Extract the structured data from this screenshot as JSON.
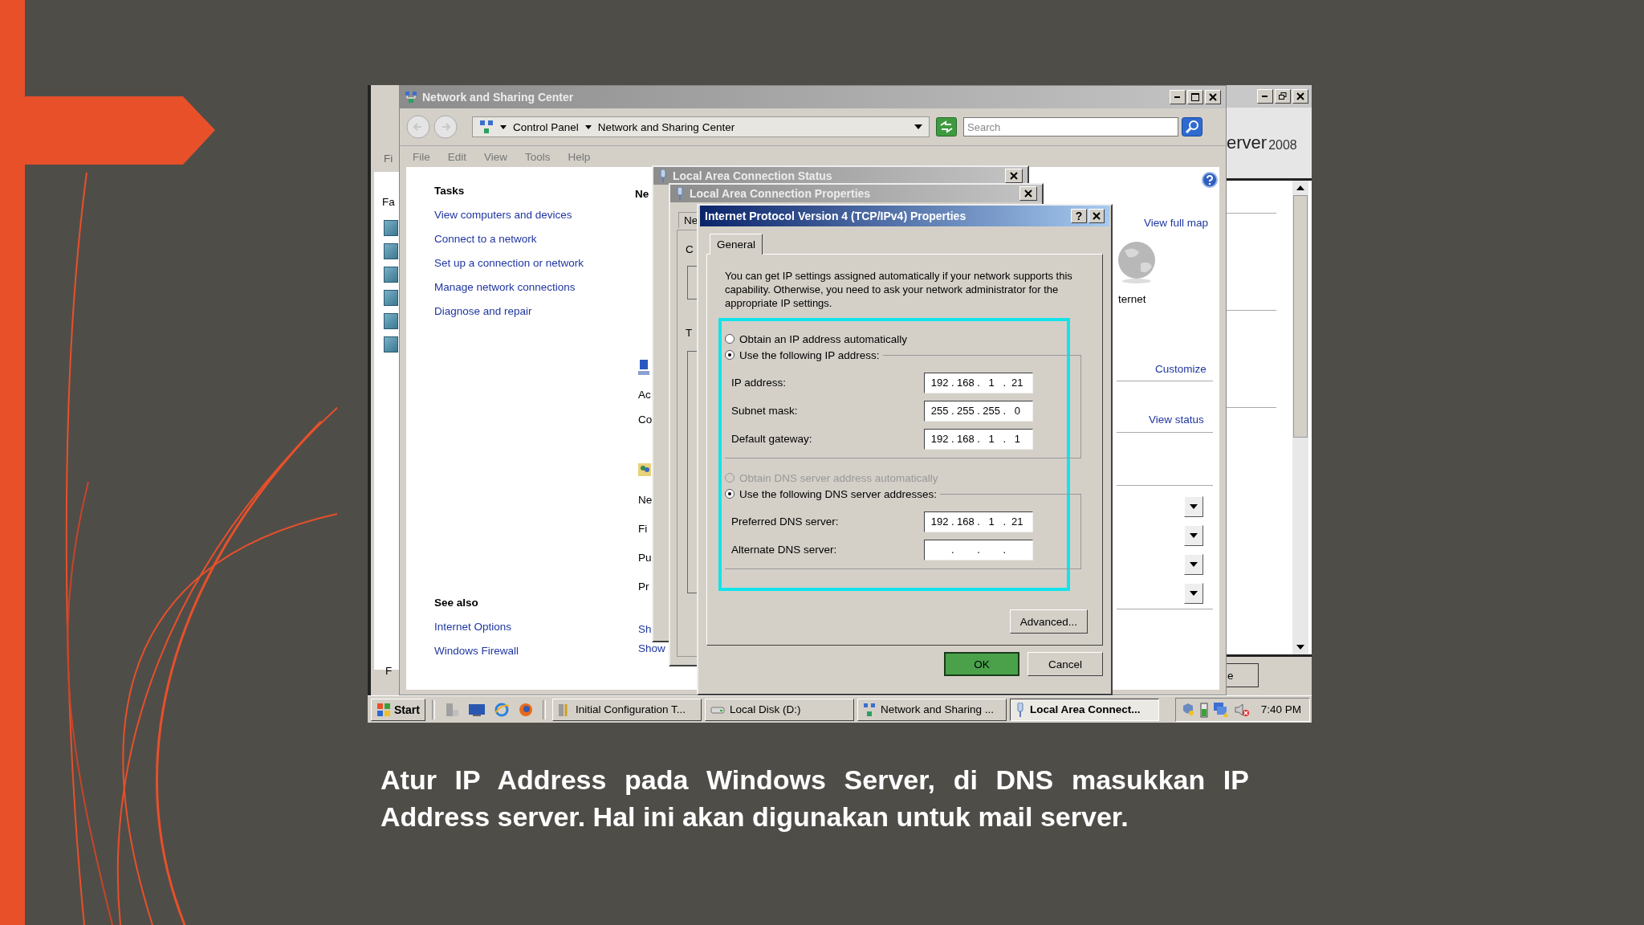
{
  "left_window": {
    "menu_fragment": "Fi",
    "label_fragment": "Fa",
    "footer_fragment": "F"
  },
  "server_window": {
    "brand_fragment": "erver",
    "version": "2008",
    "button_fragment": "e"
  },
  "nsc_window": {
    "title": "Network and Sharing Center",
    "breadcrumbs": [
      "Control Panel",
      "Network and Sharing Center"
    ],
    "search": {
      "placeholder": "Search"
    },
    "menu": [
      "File",
      "Edit",
      "View",
      "Tools",
      "Help"
    ],
    "tasks": {
      "heading": "Tasks",
      "links": [
        "View computers and devices",
        "Connect to a network",
        "Set up a connection or network",
        "Manage network connections",
        "Diagnose and repair"
      ]
    },
    "see_also": {
      "heading": "See also",
      "links": [
        "Internet Options",
        "Windows Firewall"
      ]
    },
    "middle": {
      "heading": "Ne",
      "items": [
        {
          "text": "Ac",
          "kind": "label"
        },
        {
          "text": "Co",
          "kind": "label"
        },
        {
          "text": "Ne",
          "kind": "label"
        },
        {
          "text": "Fi",
          "kind": "label"
        },
        {
          "text": "Pu",
          "kind": "label"
        },
        {
          "text": "Pr",
          "kind": "label"
        },
        {
          "text": "Sh",
          "kind": "link"
        },
        {
          "text": "Show",
          "kind": "link"
        }
      ]
    },
    "map": {
      "link": "View full map",
      "node": "ternet"
    },
    "customize": "Customize",
    "view_status": "View status"
  },
  "status_dialog": {
    "title": "Local Area Connection Status"
  },
  "properties_dialog": {
    "title": "Local Area Connection Properties",
    "tab_fragment": "Ne",
    "fragments": [
      "C",
      "T"
    ]
  },
  "ipv4_dialog": {
    "title": "Internet Protocol Version 4 (TCP/IPv4) Properties",
    "help": "?",
    "tabs": [
      {
        "label": "General",
        "selected": true
      }
    ],
    "description": "You can get IP settings assigned automatically if your network supports this capability. Otherwise, you need to ask your network administrator for the appropriate IP settings.",
    "separator": ".",
    "ip_modes": [
      {
        "label": "Obtain an IP address automatically",
        "selected": false,
        "disabled": false
      },
      {
        "label": "Use the following IP address:",
        "selected": true,
        "disabled": false
      }
    ],
    "ip_fields": [
      {
        "label": "IP address:",
        "octets": [
          "192",
          "168",
          "1",
          "21"
        ],
        "empty": false
      },
      {
        "label": "Subnet mask:",
        "octets": [
          "255",
          "255",
          "255",
          "0"
        ],
        "empty": false
      },
      {
        "label": "Default gateway:",
        "octets": [
          "192",
          "168",
          "1",
          "1"
        ],
        "empty": false
      }
    ],
    "dns_modes": [
      {
        "label": "Obtain DNS server address automatically",
        "selected": false,
        "disabled": true
      },
      {
        "label": "Use the following DNS server addresses:",
        "selected": true,
        "disabled": false
      }
    ],
    "dns_fields": [
      {
        "label": "Preferred DNS server:",
        "octets": [
          "192",
          "168",
          "1",
          "21"
        ],
        "empty": false
      },
      {
        "label": "Alternate DNS server:",
        "empty": true
      }
    ],
    "advanced": "Advanced...",
    "ok": "OK",
    "cancel": "Cancel"
  },
  "taskbar": {
    "start": "Start",
    "tasks": [
      {
        "label": "Initial Configuration T...",
        "selected": false
      },
      {
        "label": "Local Disk (D:)",
        "selected": false
      },
      {
        "label": "Network and Sharing ...",
        "selected": false
      },
      {
        "label": "Local Area Connect...",
        "selected": true
      }
    ],
    "clock": "7:40 PM"
  },
  "caption": "Atur IP Address pada Windows Server, di DNS masukkan IP Address server. Hal ini akan digunakan untuk mail server."
}
